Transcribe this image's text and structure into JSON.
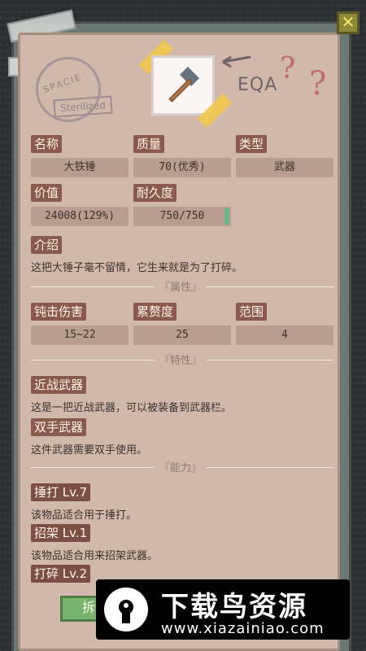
{
  "header": {
    "close_icon_glyph": "✕",
    "stamp_text": "SPACIE",
    "stamp_label": "Sterilized",
    "eqa_text": "EQA",
    "qmark": "?"
  },
  "item": {
    "icon": "hammer-icon",
    "name_label": "名称",
    "name_value": "大铁锤",
    "quality_label": "质量",
    "quality_value": "70(优秀)",
    "type_label": "类型",
    "type_value": "武器",
    "value_label": "价值",
    "value_value": "24008(129%)",
    "durability_label": "耐久度",
    "durability_value": "750/750",
    "durability_fraction": 1.0,
    "intro_label": "介绍",
    "intro_text": "这把大锤子毫不留情，它生来就是为了打碎。"
  },
  "attributes": {
    "title": "『属性』",
    "blunt_label": "钝击伤害",
    "blunt_value": "15~22",
    "fatigue_label": "累赘度",
    "fatigue_value": "25",
    "range_label": "范围",
    "range_value": "4"
  },
  "traits": {
    "title": "『特性』",
    "items": [
      {
        "name": "近战武器",
        "desc": "这是一把近战武器，可以被装备到武器栏。"
      },
      {
        "name": "双手武器",
        "desc": "这件武器需要双手使用。"
      }
    ]
  },
  "abilities": {
    "title": "『能力』",
    "items": [
      {
        "name": "捶打 Lv.7",
        "desc": "该物品适合用于捶打。"
      },
      {
        "name": "招架 Lv.1",
        "desc": "该物品适合用来招架武器。"
      },
      {
        "name": "打碎 Lv.2",
        "desc": ""
      }
    ]
  },
  "footer": {
    "button_text": "拆"
  },
  "watermark": {
    "big_text": "下载鸟资源",
    "url_text": "www.xiazainiao.com"
  },
  "colors": {
    "panel": "#d0b8aa",
    "tag": "#8a5a4f",
    "field": "#b79e90",
    "durability": "#6cb48f",
    "accent_button": "#78b36e"
  }
}
